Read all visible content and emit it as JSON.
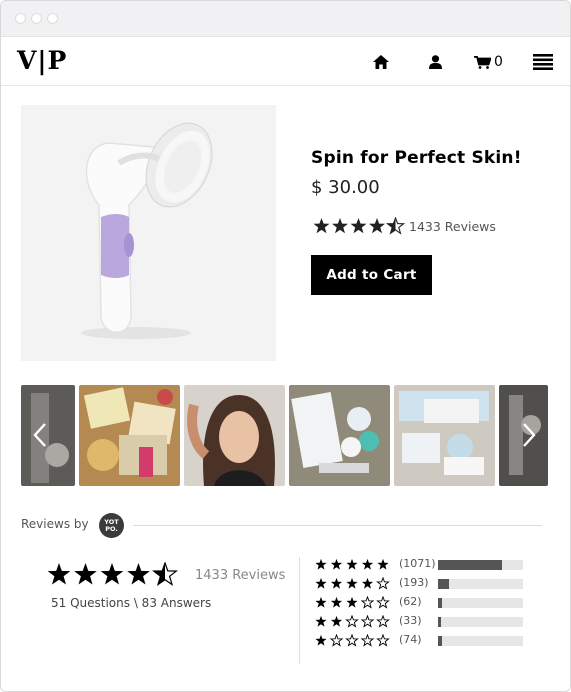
{
  "window": {
    "controls": [
      "close",
      "minimize",
      "maximize"
    ]
  },
  "header": {
    "logo": "V|P",
    "icons": [
      "home-icon",
      "user-icon",
      "cart-icon",
      "menu-icon"
    ],
    "cart_count": "0"
  },
  "product": {
    "title": "Spin for Perfect Skin!",
    "price": "$ 30.00",
    "rating": 4.5,
    "reviews_label": "1433 Reviews",
    "add_to_cart": "Add to Cart"
  },
  "gallery": {
    "thumbnails": [
      "photo-left-edge",
      "photo-packages",
      "photo-selfie",
      "photo-kit-on-rug",
      "photo-kit-box",
      "photo-right-edge"
    ],
    "prev_icon": "chevron-left-icon",
    "next_icon": "chevron-right-icon"
  },
  "reviews": {
    "label": "Reviews by",
    "badge": "YOT PO.",
    "average": 4.5,
    "count_label": "1433 Reviews",
    "qa_label": "51 Questions \\ 83 Answers",
    "distribution": [
      {
        "stars": 5,
        "count": "(1071)",
        "fraction": 0.75
      },
      {
        "stars": 4,
        "count": "(193)",
        "fraction": 0.13
      },
      {
        "stars": 3,
        "count": "(62)",
        "fraction": 0.05
      },
      {
        "stars": 2,
        "count": "(33)",
        "fraction": 0.03
      },
      {
        "stars": 1,
        "count": "(74)",
        "fraction": 0.05
      }
    ]
  },
  "colors": {
    "primary": "#000000",
    "bar": "#555555",
    "track": "#e6e6e6",
    "accent_purple": "#b9a7dd"
  }
}
